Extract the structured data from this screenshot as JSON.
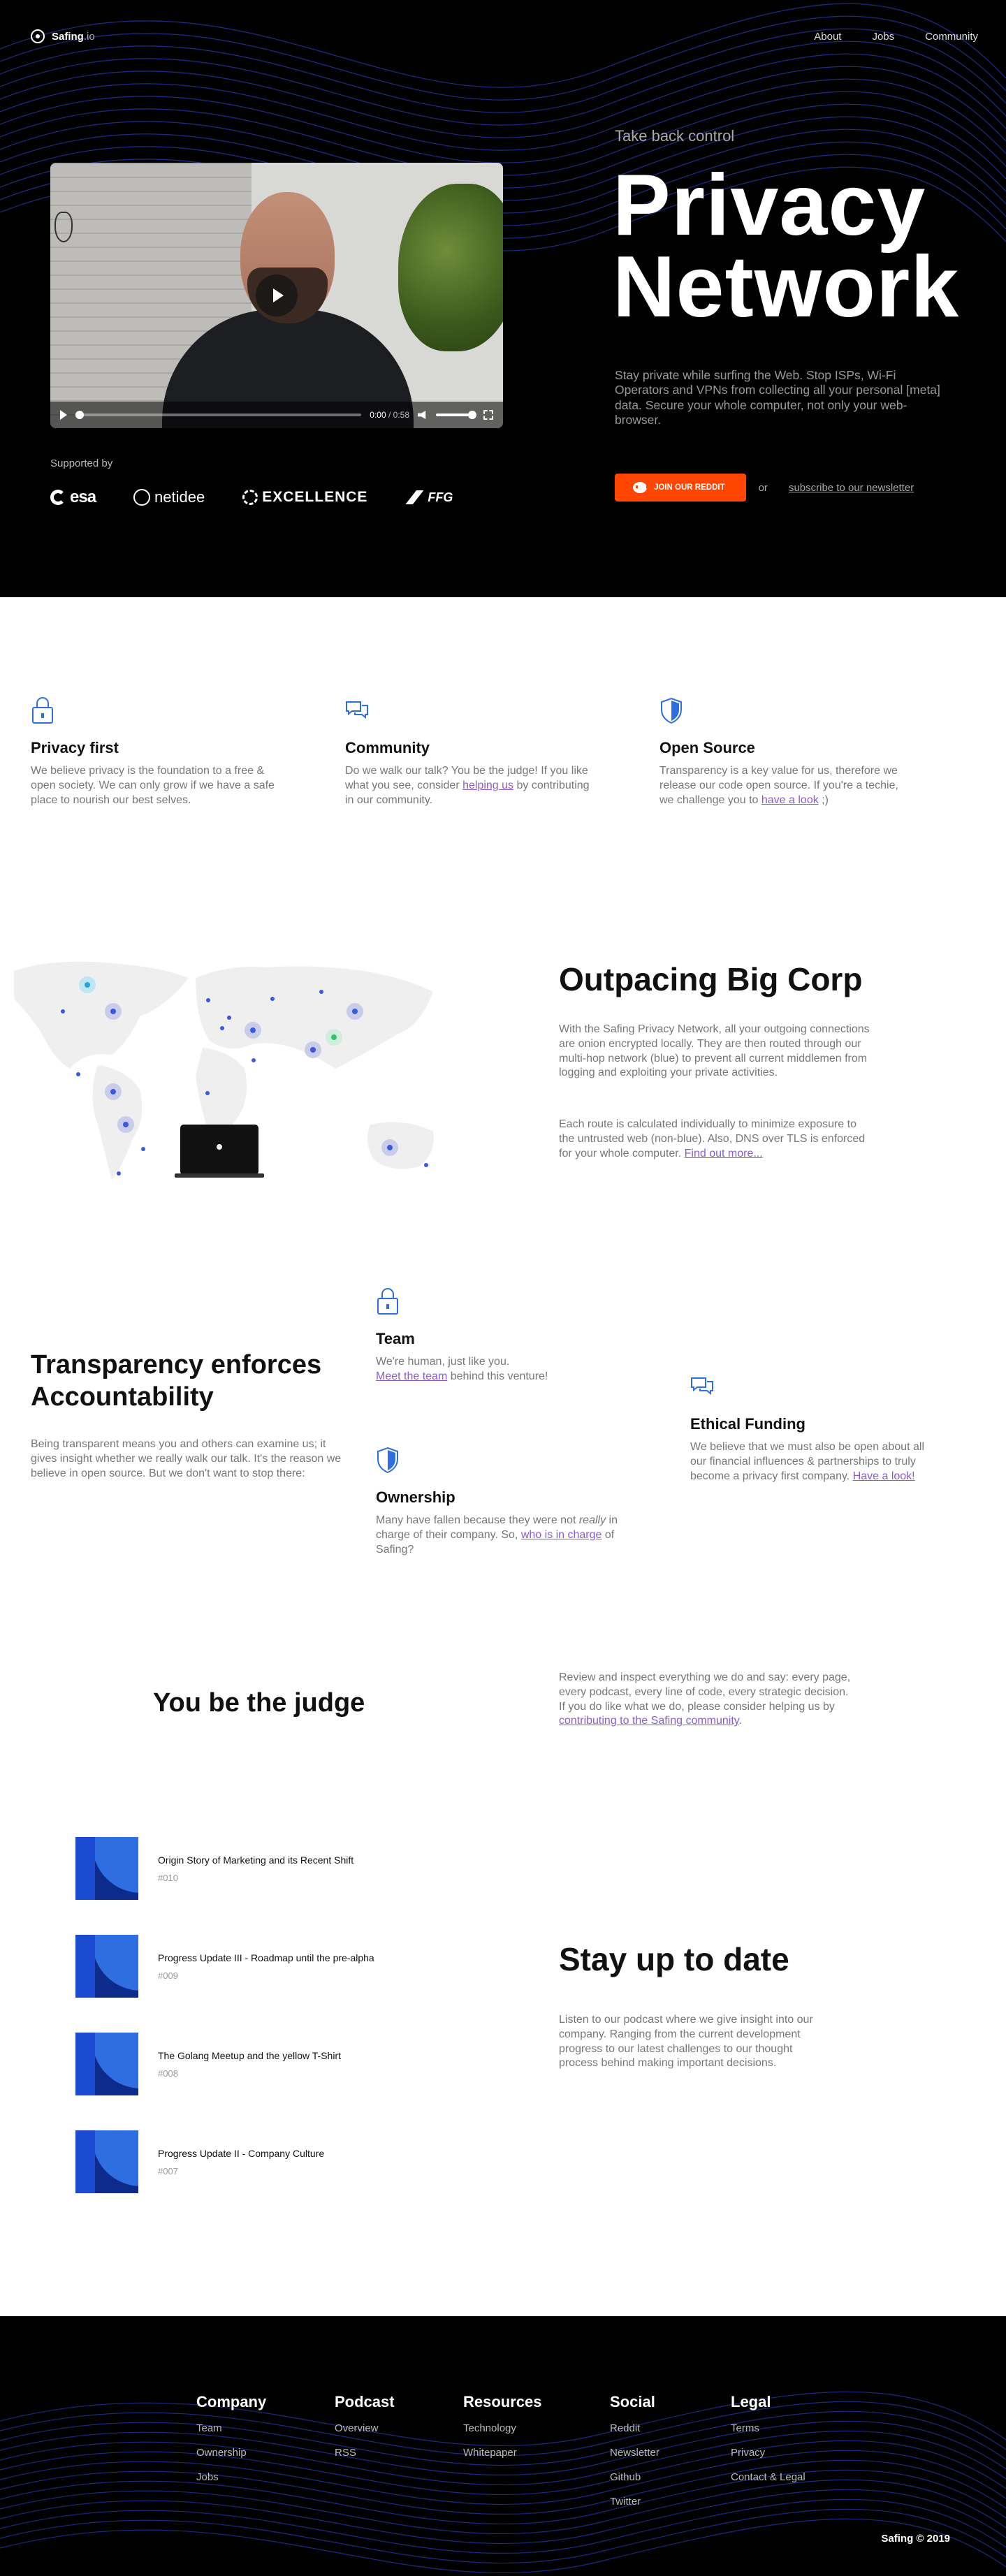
{
  "nav": {
    "logo_main": "Safing",
    "logo_suffix": ".io",
    "links": [
      "About",
      "Jobs",
      "Community"
    ]
  },
  "hero": {
    "tagline": "Take back control",
    "title_line1": "Privacy",
    "title_line2": "Network",
    "description": "Stay private while surfing the Web. Stop ISPs, Wi-Fi Operators and VPNs from collecting all your personal [meta] data. Secure your whole computer, not only your web-browser.",
    "cta_button": "JOIN OUR REDDIT",
    "cta_or": "or",
    "cta_link": "subscribe to our newsletter",
    "video": {
      "time_current": "0:00",
      "time_separator": " / ",
      "time_total": "0:58",
      "progress": 0
    },
    "supported_by": "Supported by",
    "sponsors": [
      "esa",
      "netidee",
      "EXCELLENCE",
      "FFG"
    ]
  },
  "features": [
    {
      "icon": "lock-icon",
      "title": "Privacy first",
      "text": "We believe privacy is the foundation to a free & open society. We can only grow if we have a safe place to nourish our best selves."
    },
    {
      "icon": "chat-icon",
      "title": "Community",
      "text_before": "Do we walk our talk? You be the judge! If you like what you see, consider ",
      "link": "helping us",
      "text_after": " by contributing in our community."
    },
    {
      "icon": "shield-icon",
      "title": "Open Source",
      "text_before": "Transparency is a key value for us, therefore we release our code open source. If you're a techie, we challenge you to ",
      "link": "have a look",
      "text_after": " ;)"
    }
  ],
  "network": {
    "title": "Outpacing Big Corp",
    "text1": "With the Safing Privacy Network, all your outgoing connections are onion encrypted locally. They are then routed through our multi-hop network (blue) to prevent all current middlemen from logging and exploiting your private activities.",
    "text2_before": "Each route is calculated individually to minimize exposure to the untrusted web (non-blue). Also, DNS over TLS is enforced for your whole computer. ",
    "text2_link": "Find out more..."
  },
  "transparency": {
    "title_line1": "Transparency enforces",
    "title_line2": "Accountability",
    "text": "Being transparent means you and others can examine us; it gives insight whether we really walk our talk. It's the reason we believe in open source. But we don't want to stop there:",
    "team": {
      "icon": "lock-icon",
      "title": "Team",
      "text": "We're human, just like you.",
      "link": "Meet the team",
      "text_after": " behind this venture!"
    },
    "ownership": {
      "icon": "shield-icon",
      "title": "Ownership",
      "text_before": "Many have fallen because they were not ",
      "text_em": "really",
      "text_mid": " in charge of their company. So, ",
      "link": "who is in charge",
      "text_after": " of Safing?"
    },
    "funding": {
      "icon": "chat-icon",
      "title": "Ethical Funding",
      "text_before": "We believe that we must also be open about all our financial influences & partnerships to truly become a privacy first company. ",
      "link": "Have a look!"
    }
  },
  "judge": {
    "title": "You be the judge",
    "text_before": "Review and inspect everything we do and say: every page, every podcast, every line of code, every strategic decision.\nIf you do like what we do, please consider helping us by ",
    "link": "contributing to the Safing community",
    "text_after": "."
  },
  "podcast": {
    "episodes": [
      {
        "title": "Origin Story of Marketing and its Recent Shift",
        "number": "#010"
      },
      {
        "title": "Progress Update III - Roadmap until the pre-alpha",
        "number": "#009"
      },
      {
        "title": "The Golang Meetup and the yellow T-Shirt",
        "number": "#008"
      },
      {
        "title": "Progress Update II - Company Culture",
        "number": "#007"
      }
    ],
    "title": "Stay up to date",
    "text": "Listen to our podcast where we give insight into our company. Ranging from the current development progress to our latest challenges to our thought process behind making important decisions."
  },
  "footer": {
    "columns": [
      {
        "title": "Company",
        "links": [
          "Team",
          "Ownership",
          "Jobs"
        ]
      },
      {
        "title": "Podcast",
        "links": [
          "Overview",
          "RSS"
        ]
      },
      {
        "title": "Resources",
        "links": [
          "Technology",
          "Whitepaper"
        ]
      },
      {
        "title": "Social",
        "links": [
          "Reddit",
          "Newsletter",
          "Github",
          "Twitter"
        ]
      },
      {
        "title": "Legal",
        "links": [
          "Terms",
          "Privacy",
          "Contact & Legal"
        ]
      }
    ],
    "copyright": "Safing © 2019"
  },
  "colors": {
    "accent_purple": "#8a5cd0",
    "icon_blue": "#2f6ee0",
    "reddit_orange": "#ff4500",
    "hero_bg": "#000000"
  }
}
